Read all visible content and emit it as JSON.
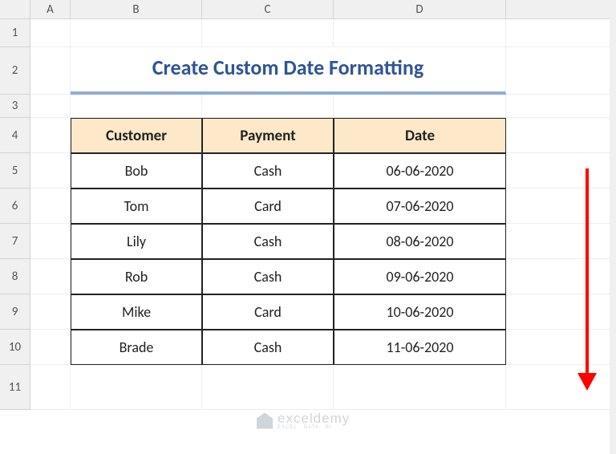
{
  "columns": [
    "A",
    "B",
    "C",
    "D"
  ],
  "rows": [
    "1",
    "2",
    "3",
    "4",
    "5",
    "6",
    "7",
    "8",
    "9",
    "10",
    "11"
  ],
  "title": "Create Custom Date Formatting",
  "headers": {
    "b": "Customer",
    "c": "Payment",
    "d": "Date"
  },
  "data": [
    {
      "customer": "Bob",
      "payment": "Cash",
      "date": "06-06-2020"
    },
    {
      "customer": "Tom",
      "payment": "Card",
      "date": "07-06-2020"
    },
    {
      "customer": "Lily",
      "payment": "Cash",
      "date": "08-06-2020"
    },
    {
      "customer": "Rob",
      "payment": "Cash",
      "date": "09-06-2020"
    },
    {
      "customer": "Mike",
      "payment": "Card",
      "date": "10-06-2020"
    },
    {
      "customer": "Brade",
      "payment": "Cash",
      "date": "11-06-2020"
    }
  ],
  "watermark": {
    "main": "exceldemy",
    "sub": "EXCEL · DATA · BI"
  },
  "chart_data": {
    "type": "table",
    "title": "Create Custom Date Formatting",
    "columns": [
      "Customer",
      "Payment",
      "Date"
    ],
    "rows": [
      [
        "Bob",
        "Cash",
        "06-06-2020"
      ],
      [
        "Tom",
        "Card",
        "07-06-2020"
      ],
      [
        "Lily",
        "Cash",
        "08-06-2020"
      ],
      [
        "Rob",
        "Cash",
        "09-06-2020"
      ],
      [
        "Mike",
        "Card",
        "10-06-2020"
      ],
      [
        "Brade",
        "Cash",
        "11-06-2020"
      ]
    ]
  }
}
